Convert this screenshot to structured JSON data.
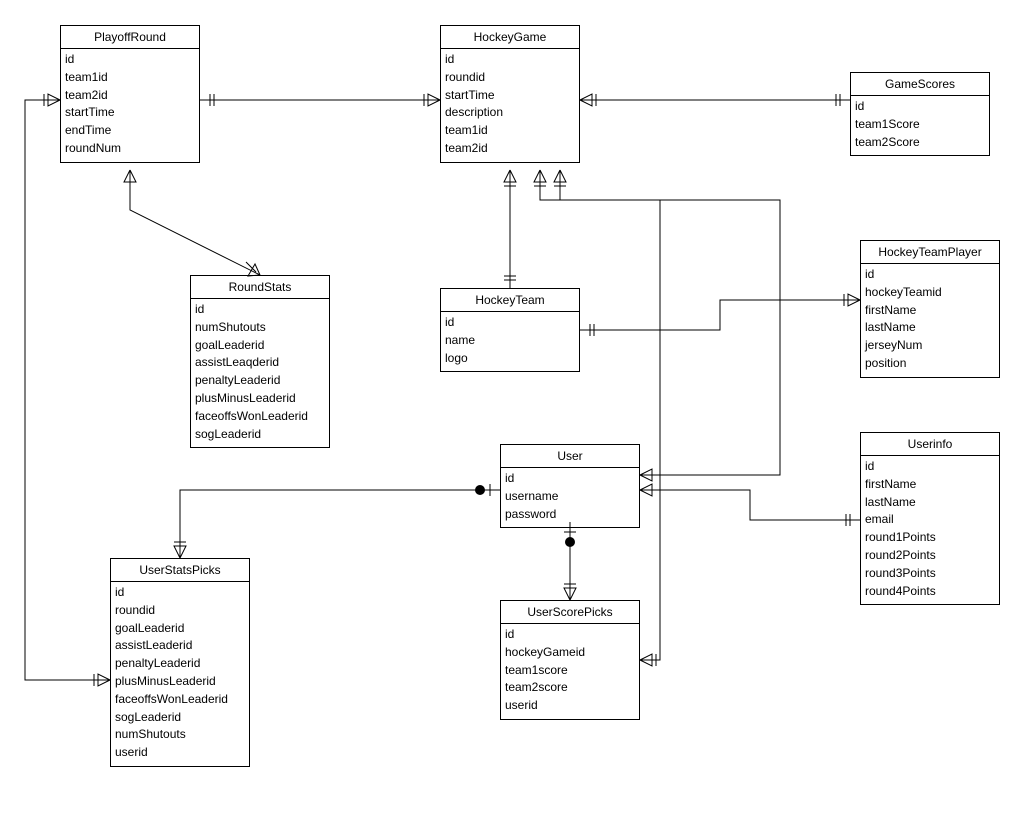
{
  "entities": {
    "playoffRound": {
      "title": "PlayoffRound",
      "attrs": [
        "id",
        "team1id",
        "team2id",
        "startTime",
        "endTime",
        "roundNum"
      ]
    },
    "hockeyGame": {
      "title": "HockeyGame",
      "attrs": [
        "id",
        "roundid",
        "startTime",
        "description",
        "team1id",
        "team2id"
      ]
    },
    "gameScores": {
      "title": "GameScores",
      "attrs": [
        "id",
        "team1Score",
        "team2Score"
      ]
    },
    "hockeyTeamPlayer": {
      "title": "HockeyTeamPlayer",
      "attrs": [
        "id",
        "hockeyTeamid",
        "firstName",
        "lastName",
        "jerseyNum",
        "position"
      ]
    },
    "roundStats": {
      "title": "RoundStats",
      "attrs": [
        "id",
        "numShutouts",
        "goalLeaderid",
        "assistLeaqderid",
        "penaltyLeaderid",
        "plusMinusLeaderid",
        "faceoffsWonLeaderid",
        "sogLeaderid"
      ]
    },
    "hockeyTeam": {
      "title": "HockeyTeam",
      "attrs": [
        "id",
        "name",
        "logo"
      ]
    },
    "user": {
      "title": "User",
      "attrs": [
        "id",
        "username",
        "password"
      ]
    },
    "userInfo": {
      "title": "Userinfo",
      "attrs": [
        "id",
        "firstName",
        "lastName",
        "email",
        "round1Points",
        "round2Points",
        "round3Points",
        "round4Points"
      ]
    },
    "userStatsPicks": {
      "title": "UserStatsPicks",
      "attrs": [
        "id",
        "roundid",
        "goalLeaderid",
        "assistLeaderid",
        "penaltyLeaderid",
        "plusMinusLeaderid",
        "faceoffsWonLeaderid",
        "sogLeaderid",
        "numShutouts",
        "userid"
      ]
    },
    "userScorePicks": {
      "title": "UserScorePicks",
      "attrs": [
        "id",
        "hockeyGameid",
        "team1score",
        "team2score",
        "userid"
      ]
    }
  }
}
